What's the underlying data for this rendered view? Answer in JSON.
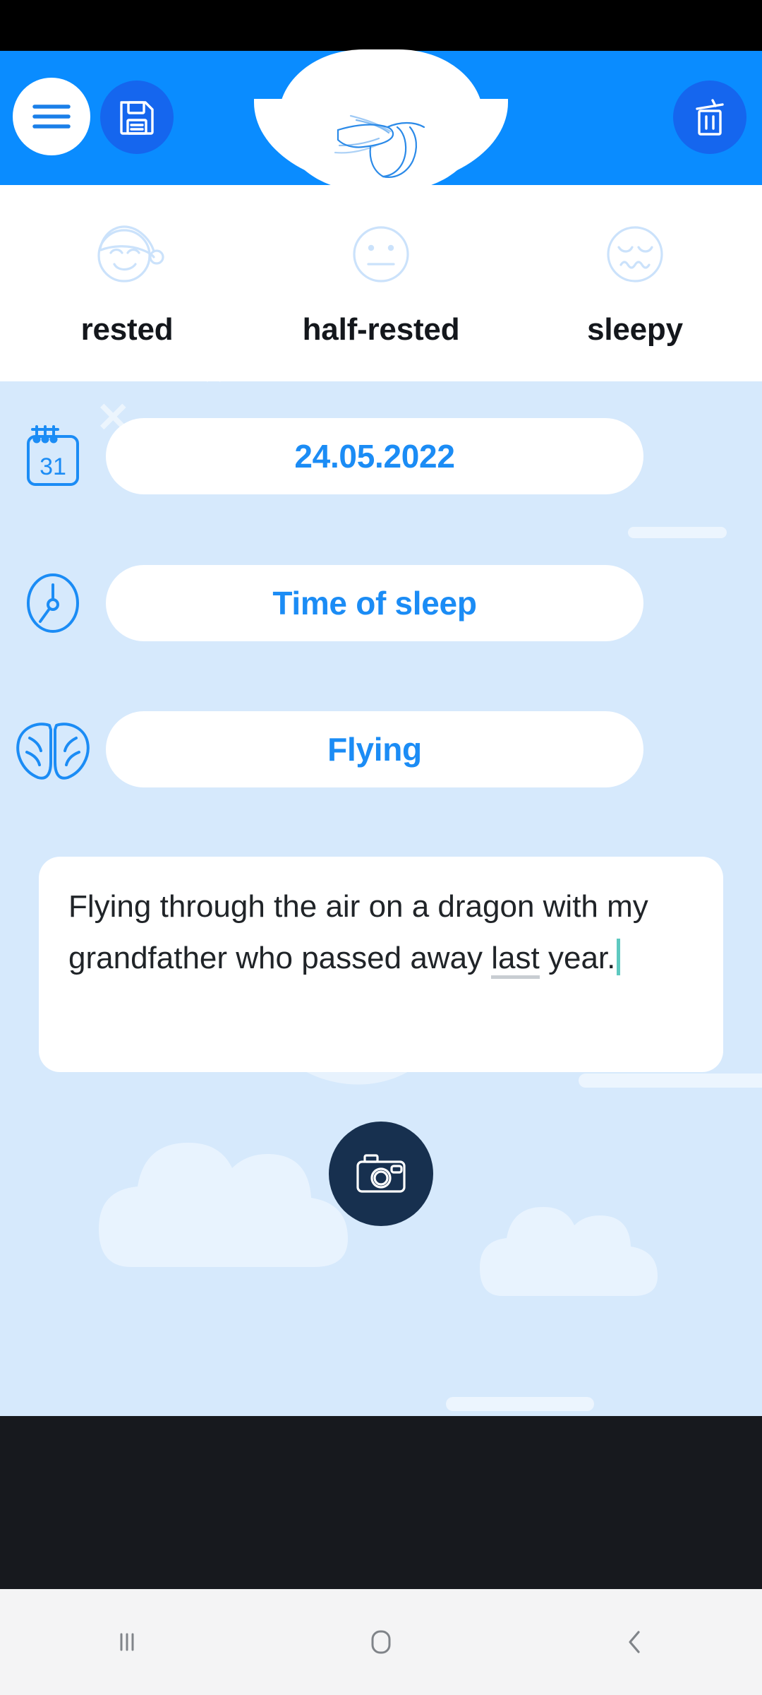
{
  "app": {
    "header": {
      "menu_button": "menu-icon",
      "save_button": "save-icon",
      "delete_button": "trash-icon",
      "logo": "hummingbird-logo",
      "bg_color": "#0a8cff",
      "button_color": "#1566ee"
    },
    "mood_selector": {
      "options": [
        {
          "label": "rested",
          "icon": "sleeping-face-nightcap-icon"
        },
        {
          "label": "half-rested",
          "icon": "neutral-face-icon"
        },
        {
          "label": "sleepy",
          "icon": "sleepy-face-icon"
        }
      ]
    },
    "fields": [
      {
        "icon": "calendar-icon",
        "value": "24.05.2022",
        "calendar_day": "31"
      },
      {
        "icon": "clock-icon",
        "value": "Time of sleep"
      },
      {
        "icon": "wings-icon",
        "value": "Flying"
      }
    ],
    "note": {
      "text_before": "Flying through the air on a dragon with my grandfather who passed away ",
      "text_spellcheck": "last",
      "text_after": " year.",
      "caret_color": "#5ec9c0"
    },
    "camera_button": {
      "icon": "camera-icon",
      "color": "#17304f"
    },
    "colors": {
      "accent": "#1b8cf5",
      "background": "#d6e9fc",
      "card": "#ffffff",
      "text": "#14171c"
    }
  },
  "system_nav": {
    "items": [
      {
        "name": "recents",
        "icon": "recents-icon"
      },
      {
        "name": "home",
        "icon": "home-icon"
      },
      {
        "name": "back",
        "icon": "back-chevron-icon"
      }
    ]
  }
}
